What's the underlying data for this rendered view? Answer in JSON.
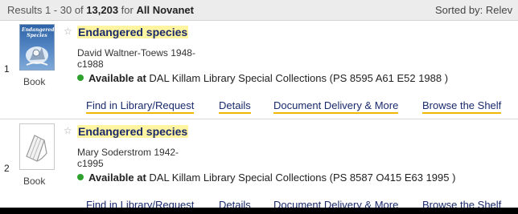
{
  "header": {
    "results_prefix": "Results 1 - 30 of",
    "total": "13,203",
    "for_text": "for",
    "scope": "All Novanet",
    "sorted_by": "Sorted by: Relev"
  },
  "records": [
    {
      "number": "1",
      "format": "Book",
      "cover_text": "Endangered Species",
      "title": "Endangered species",
      "author": "David Waltner-Toews 1948-",
      "date": "c1988",
      "avail_label": "Available at",
      "avail_text": " DAL Killam Library Special Collections (PS 8595 A61 E52 1988 )",
      "actions": [
        "Find in Library/Request",
        "Details",
        "Document Delivery & More",
        "Browse the Shelf"
      ]
    },
    {
      "number": "2",
      "format": "Book",
      "title": "Endangered species",
      "author": "Mary Soderstrom 1942-",
      "date": "c1995",
      "avail_label": "Available at",
      "avail_text": " DAL Killam Library Special Collections (PS 8587 O415 E63 1995 )",
      "actions": [
        "Find in Library/Request",
        "Details",
        "Document Delivery & More",
        "Browse the Shelf"
      ]
    }
  ],
  "icons": {
    "favorite": "star-outline-icon",
    "available": "green-dot-icon",
    "no_cover": "book-placeholder-icon"
  },
  "colors": {
    "link": "#1a2a6c",
    "title_highlight": "#fff4a0",
    "action_underline": "#f0b800",
    "available": "#2fa12f",
    "header_bg": "#ececec"
  }
}
